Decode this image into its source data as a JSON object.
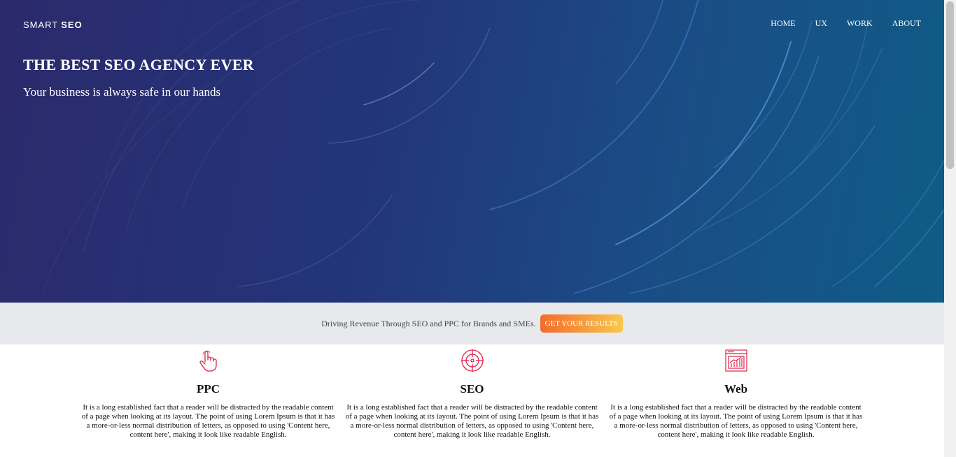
{
  "brand": {
    "name_light": "SMART",
    "name_bold": "SEO"
  },
  "nav": {
    "items": [
      "HOME",
      "UX",
      "WORK",
      "ABOUT"
    ]
  },
  "hero": {
    "title": "THE BEST SEO AGENCY EVER",
    "subtitle": "Your business is always safe in our hands"
  },
  "cta": {
    "text": "Driving Revenue Through SEO and PPC for Brands and SMEs.",
    "button_label": "GET YOUR RESULTS"
  },
  "services": [
    {
      "icon": "pointer-hand-icon",
      "title": "PPC",
      "text": "It is a long established fact that a reader will be distracted by the readable content of a page when looking at its layout. The point of using Lorem Ipsum is that it has a more-or-less normal distribution of letters, as opposed to using 'Content here, content here', making it look like readable English."
    },
    {
      "icon": "target-icon",
      "title": "SEO",
      "text": "It is a long established fact that a reader will be distracted by the readable content of a page when looking at its layout. The point of using Lorem Ipsum is that it has a more-or-less normal distribution of letters, as opposed to using 'Content here, content here', making it look like readable English."
    },
    {
      "icon": "web-chart-icon",
      "title": "Web",
      "text": "It is a long established fact that a reader will be distracted by the readable content of a page when looking at its layout. The point of using Lorem Ipsum is that it has a more-or-less normal distribution of letters, as opposed to using 'Content here, content here', making it look like readable English."
    }
  ],
  "colors": {
    "accent_icon": "#e0224a",
    "cta_start": "#f36b2b",
    "cta_end": "#f7c84c",
    "band_bg": "#e8e9ec"
  }
}
